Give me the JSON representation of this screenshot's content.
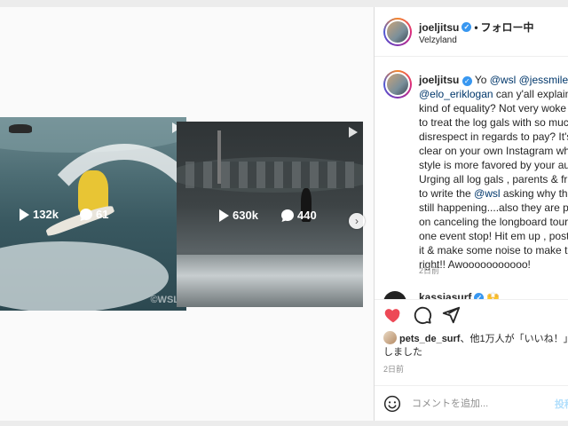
{
  "colors": {
    "accent": "#3897f0",
    "like": "#ed4956",
    "mention": "#00376b"
  },
  "grid": {
    "posts": [
      {
        "views": "132k",
        "comments": "61",
        "watermark": "©WSL"
      },
      {
        "views": "630k",
        "comments": "440"
      }
    ]
  },
  "header": {
    "username": "joeljitsu",
    "separator": "•",
    "follow_status": "フォロー中",
    "location": "Velzyland"
  },
  "caption": {
    "username": "joeljitsu",
    "line1_start": "Yo ",
    "line1_m1": "@wsl",
    "line1_mid": " ",
    "line1_m2": "@jessmileydyer",
    "line2_m": "@elo_eriklogan",
    "line2_text": " can y'all explain this",
    "lines": [
      "kind of equality? Not very woke of you",
      "to treat the log gals with so much",
      "disrespect in regards to pay? It's pretty",
      "clear on your own Instagram which",
      "style is more favored by your audience.",
      "Urging all log gals , parents & friends"
    ],
    "line9_start": "to write the ",
    "line9_m": "@wsl",
    "line9_end": " asking why this is",
    "lines_end": [
      "still happening....also they are planning",
      "on canceling the longboard tour to just",
      "one event stop! Hit em up , post about",
      "it & make some noise to make things",
      "right!! Awooooooooooo!"
    ],
    "time": "2日前"
  },
  "next_comment": {
    "username": "kassiasurf",
    "emoji": "🙌"
  },
  "actions": {
    "like_icon": "heart-icon",
    "comment_icon": "comment-icon",
    "share_icon": "send-icon"
  },
  "likes": {
    "user": "pets_de_surf",
    "text": "、他1万人が「いいね！」しました"
  },
  "post_date": "2日前",
  "comment_box": {
    "placeholder": "コメントを追加...",
    "post_label": "投稿する"
  }
}
